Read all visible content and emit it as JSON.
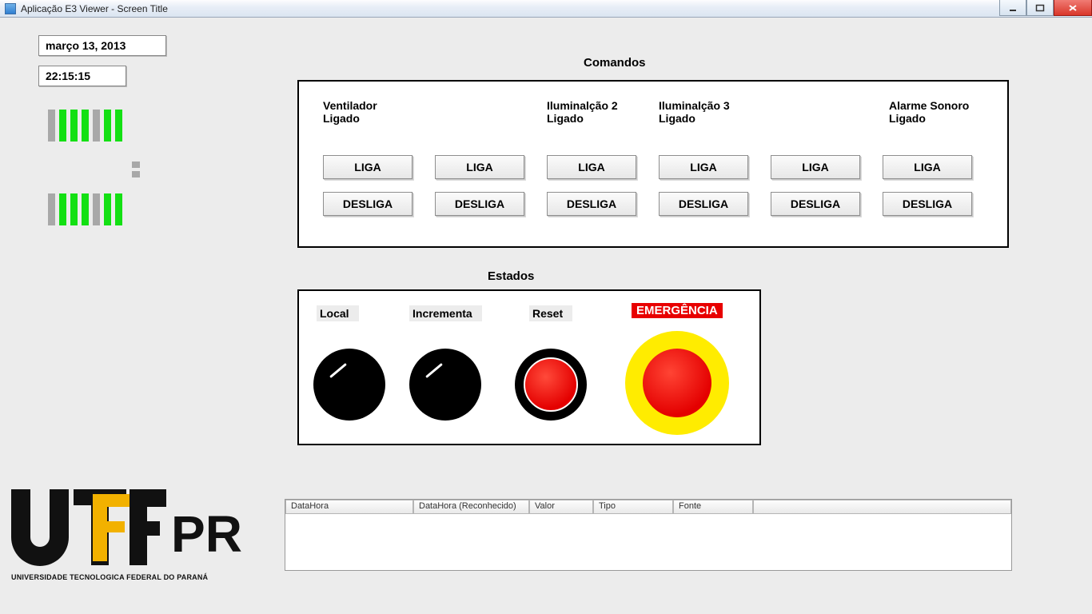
{
  "window": {
    "title": "Aplicação E3 Viewer - Screen Title"
  },
  "datetime": {
    "date": "março 13, 2013",
    "time": "22:15:15"
  },
  "sections": {
    "comandos": "Comandos",
    "estados": "Estados"
  },
  "commands": {
    "liga": "LIGA",
    "desliga": "DESLIGA",
    "cols": [
      {
        "label": "Ventilador\nLigado"
      },
      {
        "label": ""
      },
      {
        "label": "Iluminalção 2\nLigado"
      },
      {
        "label": "Iluminalção 3\nLigado"
      },
      {
        "label": ""
      },
      {
        "label": "Alarme Sonoro\nLigado"
      }
    ]
  },
  "states": {
    "local": "Local",
    "incrementa": "Incrementa",
    "reset": "Reset",
    "emergencia": "EMERGÊNCIA"
  },
  "grid": {
    "headers": [
      "DataHora",
      "DataHora (Reconhecido)",
      "Valor",
      "Tipo",
      "Fonte",
      ""
    ]
  },
  "logo": {
    "text": "PR",
    "subtitle": "UNIVERSIDADE TECNOLOGICA FEDERAL DO PARANÁ"
  }
}
